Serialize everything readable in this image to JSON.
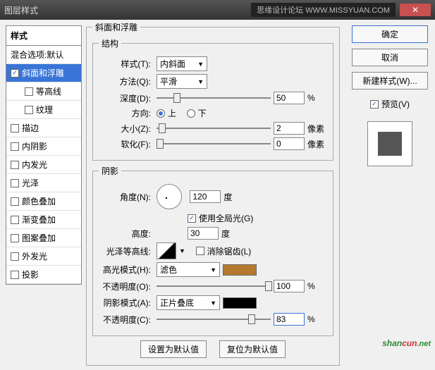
{
  "window": {
    "title": "图层样式",
    "banner": "思缘设计论坛  WWW.MISSYUAN.COM"
  },
  "sidebar": {
    "header": "样式",
    "blend": "混合选项:默认",
    "items": [
      {
        "label": "斜面和浮雕",
        "checked": true,
        "selected": true
      },
      {
        "label": "等高线",
        "checked": false,
        "sub": true
      },
      {
        "label": "纹理",
        "checked": false,
        "sub": true
      },
      {
        "label": "描边",
        "checked": false
      },
      {
        "label": "内阴影",
        "checked": false
      },
      {
        "label": "内发光",
        "checked": false
      },
      {
        "label": "光泽",
        "checked": false
      },
      {
        "label": "颜色叠加",
        "checked": false
      },
      {
        "label": "渐变叠加",
        "checked": false
      },
      {
        "label": "图案叠加",
        "checked": false
      },
      {
        "label": "外发光",
        "checked": false
      },
      {
        "label": "投影",
        "checked": false
      }
    ]
  },
  "bevel": {
    "group": "斜面和浮雕",
    "structure": "结构",
    "style_lbl": "样式(T):",
    "style_val": "内斜面",
    "method_lbl": "方法(Q):",
    "method_val": "平滑",
    "depth_lbl": "深度(D):",
    "depth_val": "50",
    "pct": "%",
    "dir_lbl": "方向:",
    "up": "上",
    "down": "下",
    "size_lbl": "大小(Z):",
    "size_val": "2",
    "px": "像素",
    "soften_lbl": "软化(F):",
    "soften_val": "0"
  },
  "shade": {
    "group": "阴影",
    "angle_lbl": "角度(N):",
    "angle_val": "120",
    "deg": "度",
    "global": "使用全局光(G)",
    "alt_lbl": "高度:",
    "alt_val": "30",
    "gloss_lbl": "光泽等高线:",
    "aa": "消除锯齿(L)",
    "hl_mode_lbl": "高光模式(H):",
    "hl_mode_val": "滤色",
    "hl_color": "#b47a2e",
    "hl_op_lbl": "不透明度(O):",
    "hl_op_val": "100",
    "sh_mode_lbl": "阴影模式(A):",
    "sh_mode_val": "正片叠底",
    "sh_color": "#000000",
    "sh_op_lbl": "不透明度(C):",
    "sh_op_val": "83"
  },
  "footer": {
    "default": "设置为默认值",
    "reset": "复位为默认值"
  },
  "right": {
    "ok": "确定",
    "cancel": "取消",
    "newstyle": "新建样式(W)...",
    "preview": "预览(V)"
  },
  "watermark": {
    "a": "shan",
    "b": "cun",
    "suffix": ".net"
  }
}
